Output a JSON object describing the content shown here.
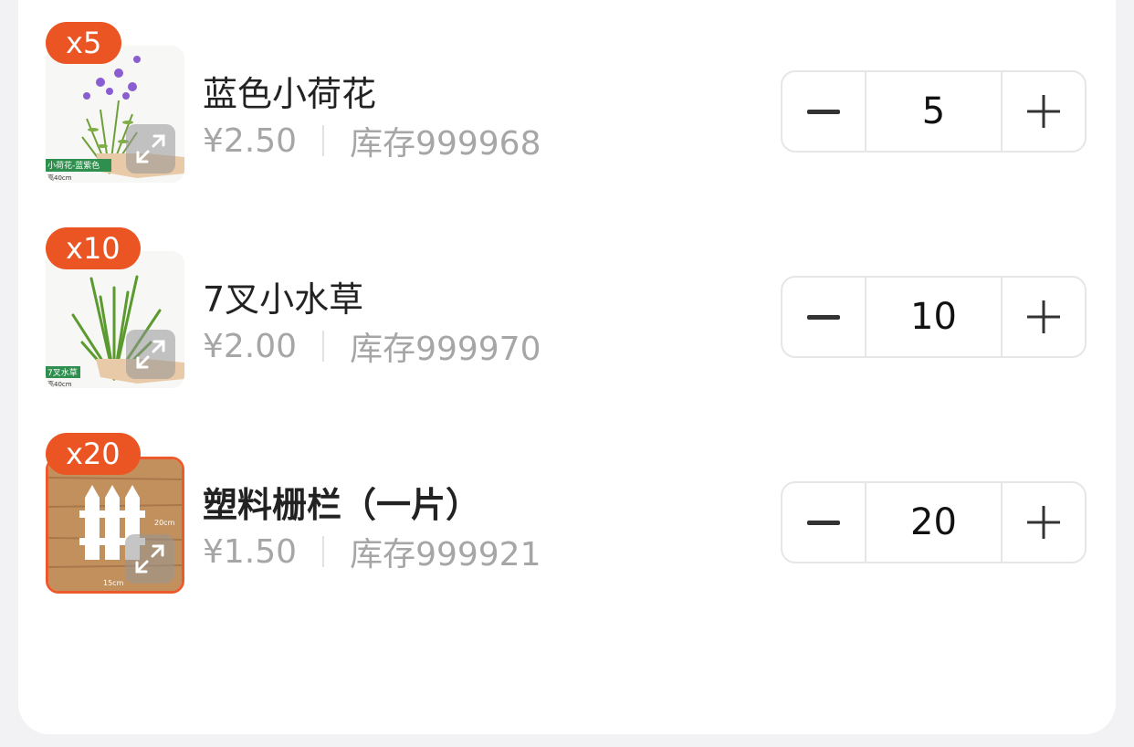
{
  "items": [
    {
      "badge": "x5",
      "name": "蓝色小荷花",
      "price": "¥2.50",
      "stock": "库存999968",
      "quantity": "5",
      "image_caption": "小荷花-蓝紫色",
      "image_subcaption": "高40cm"
    },
    {
      "badge": "x10",
      "name": "7叉小水草",
      "price": "¥2.00",
      "stock": "库存999970",
      "quantity": "10",
      "image_caption": "7叉水草",
      "image_subcaption": "高40cm"
    },
    {
      "badge": "x20",
      "name": "塑料栅栏（一片）",
      "price": "¥1.50",
      "stock": "库存999921",
      "quantity": "20",
      "image_caption": "20cm",
      "image_subcaption": "15cm"
    }
  ],
  "colors": {
    "accent": "#ea5523",
    "text": "#222222",
    "muted": "#a6a6a6",
    "border": "#e6e6e6"
  }
}
